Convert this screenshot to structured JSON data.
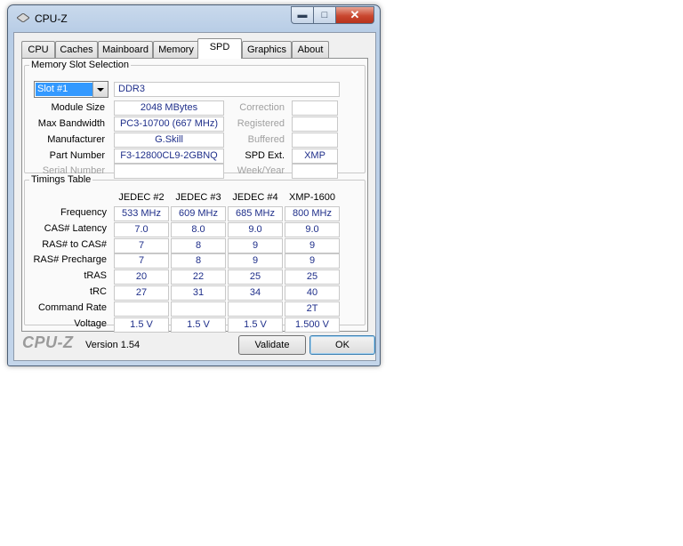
{
  "window": {
    "title": "CPU-Z"
  },
  "tabs": [
    "CPU",
    "Caches",
    "Mainboard",
    "Memory",
    "SPD",
    "Graphics",
    "About"
  ],
  "slot": {
    "legend": "Memory Slot Selection",
    "selected": "Slot #1",
    "type": "DDR3",
    "fields": {
      "module_size": {
        "label": "Module Size",
        "value": "2048 MBytes"
      },
      "max_bandwidth": {
        "label": "Max Bandwidth",
        "value": "PC3-10700 (667 MHz)"
      },
      "manufacturer": {
        "label": "Manufacturer",
        "value": "G.Skill"
      },
      "part_number": {
        "label": "Part Number",
        "value": "F3-12800CL9-2GBNQ"
      },
      "serial_number": {
        "label": "Serial Number",
        "value": ""
      },
      "correction": {
        "label": "Correction",
        "value": ""
      },
      "registered": {
        "label": "Registered",
        "value": ""
      },
      "buffered": {
        "label": "Buffered",
        "value": ""
      },
      "spd_ext": {
        "label": "SPD Ext.",
        "value": "XMP"
      },
      "week_year": {
        "label": "Week/Year",
        "value": ""
      }
    }
  },
  "timings": {
    "legend": "Timings Table",
    "columns": [
      "JEDEC #2",
      "JEDEC #3",
      "JEDEC #4",
      "XMP-1600"
    ],
    "rows": [
      {
        "label": "Frequency",
        "values": [
          "533 MHz",
          "609 MHz",
          "685 MHz",
          "800 MHz"
        ]
      },
      {
        "label": "CAS# Latency",
        "values": [
          "7.0",
          "8.0",
          "9.0",
          "9.0"
        ]
      },
      {
        "label": "RAS# to CAS#",
        "values": [
          "7",
          "8",
          "9",
          "9"
        ]
      },
      {
        "label": "RAS# Precharge",
        "values": [
          "7",
          "8",
          "9",
          "9"
        ]
      },
      {
        "label": "tRAS",
        "values": [
          "20",
          "22",
          "25",
          "25"
        ]
      },
      {
        "label": "tRC",
        "values": [
          "27",
          "31",
          "34",
          "40"
        ]
      },
      {
        "label": "Command Rate",
        "values": [
          "",
          "",
          "",
          "2T"
        ]
      },
      {
        "label": "Voltage",
        "values": [
          "1.5 V",
          "1.5 V",
          "1.5 V",
          "1.500 V"
        ]
      }
    ]
  },
  "footer": {
    "logo": "CPU-Z",
    "version": "Version 1.54",
    "validate": "Validate",
    "ok": "OK"
  }
}
